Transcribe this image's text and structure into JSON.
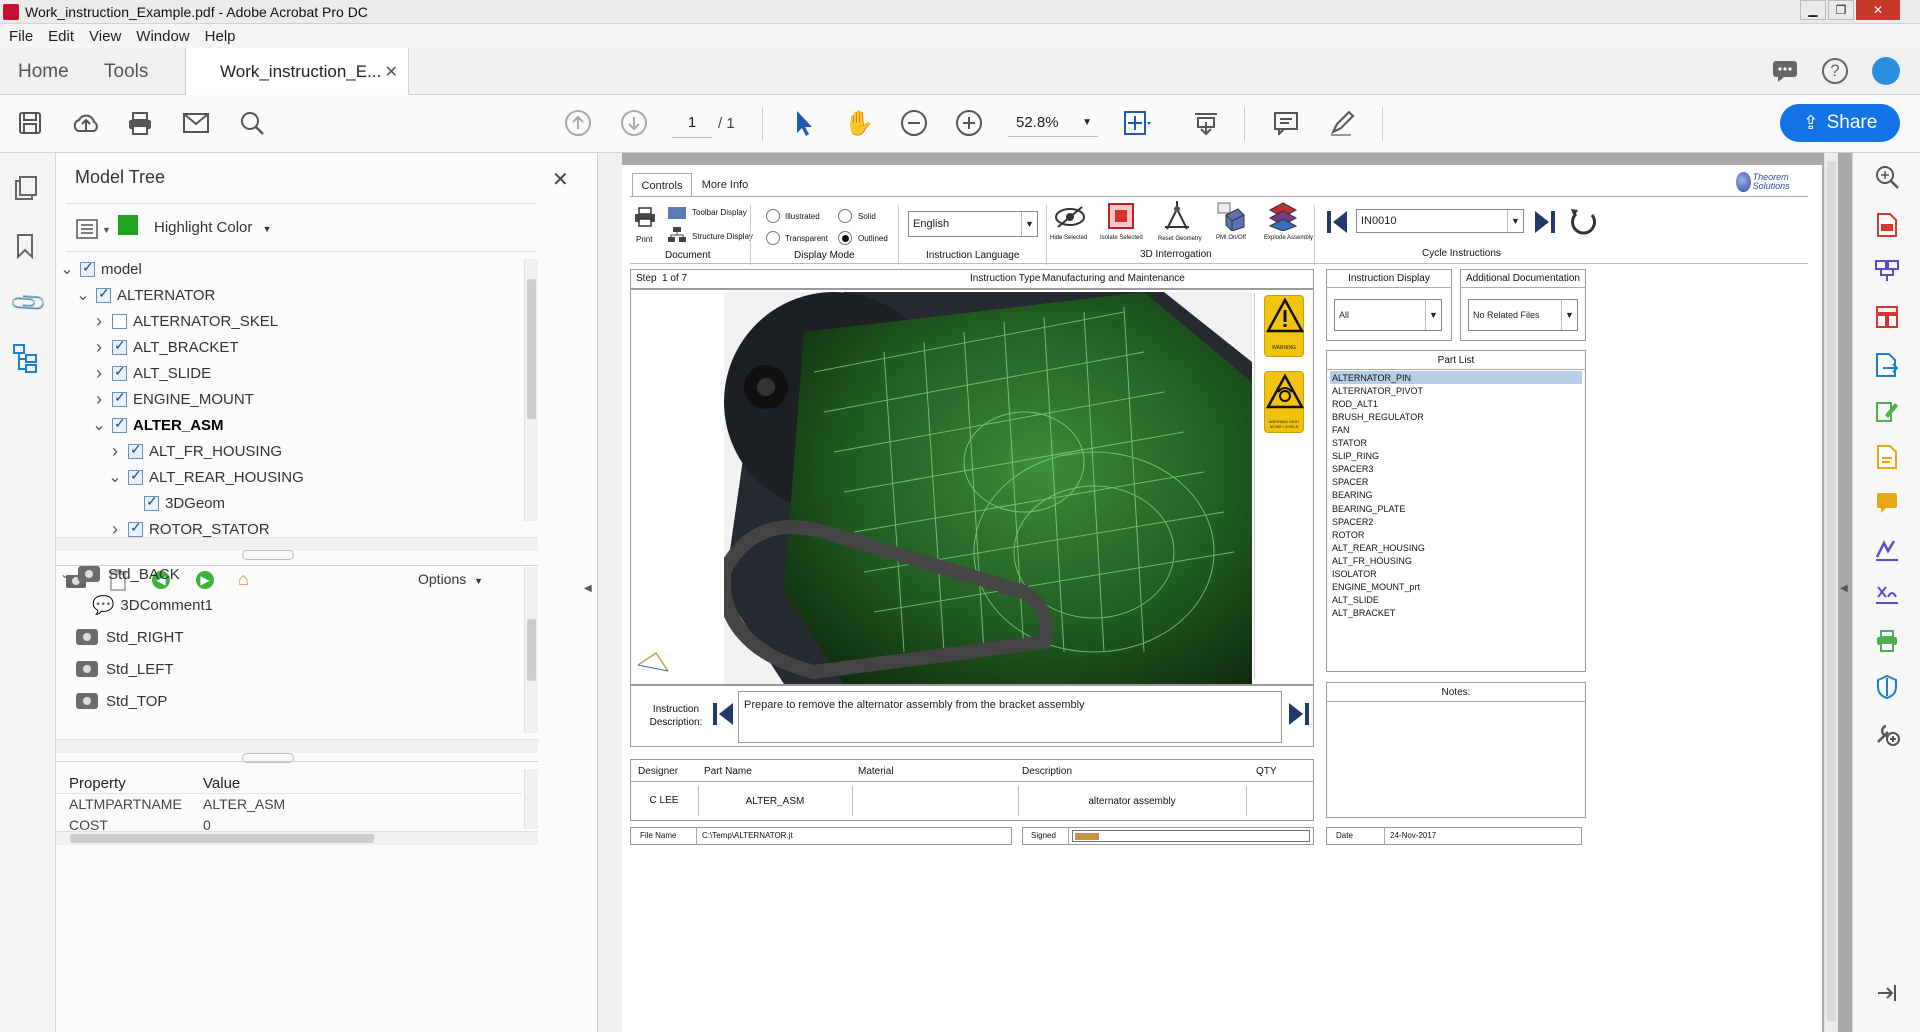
{
  "window": {
    "title": "Work_instruction_Example.pdf - Adobe Acrobat Pro DC"
  },
  "menu": [
    "File",
    "Edit",
    "View",
    "Window",
    "Help"
  ],
  "tabs": {
    "home": "Home",
    "tools": "Tools",
    "doc": "Work_instruction_E..."
  },
  "toolbar": {
    "page_current": "1",
    "page_total": "/ 1",
    "zoom": "52.8%",
    "share": "Share"
  },
  "model_tree": {
    "title": "Model Tree",
    "highlight": "Highlight Color",
    "highlight_color": "#1fa31f",
    "items": [
      {
        "label": "model",
        "level": 0,
        "expanded": true,
        "checked": true
      },
      {
        "label": "ALTERNATOR",
        "level": 1,
        "expanded": true,
        "checked": true
      },
      {
        "label": "ALTERNATOR_SKEL",
        "level": 2,
        "expanded": false,
        "checked": false
      },
      {
        "label": "ALT_BRACKET",
        "level": 2,
        "expanded": false,
        "checked": true
      },
      {
        "label": "ALT_SLIDE",
        "level": 2,
        "expanded": false,
        "checked": true
      },
      {
        "label": "ENGINE_MOUNT",
        "level": 2,
        "expanded": false,
        "checked": true
      },
      {
        "label": "ALTER_ASM",
        "level": 2,
        "expanded": true,
        "checked": true,
        "bold": true
      },
      {
        "label": "ALT_FR_HOUSING",
        "level": 3,
        "expanded": false,
        "checked": true
      },
      {
        "label": "ALT_REAR_HOUSING",
        "level": 3,
        "expanded": true,
        "checked": true
      },
      {
        "label": "3DGeom",
        "level": 4,
        "checked": true,
        "leaf": true
      },
      {
        "label": "ROTOR_STATOR",
        "level": 3,
        "expanded": false,
        "checked": true
      }
    ],
    "options": "Options",
    "views": [
      "Std_BACK",
      "3DComment1",
      "Std_RIGHT",
      "Std_LEFT",
      "Std_TOP"
    ],
    "property_header": "Property",
    "value_header": "Value",
    "properties": [
      {
        "name": "ALTMPARTNAME",
        "value": "ALTER_ASM"
      },
      {
        "name": "COST",
        "value": "0"
      }
    ]
  },
  "pdf": {
    "tabs": [
      "Controls",
      "More Info"
    ],
    "logo": "Theorem Solutions",
    "document": {
      "print": "Print",
      "toolbar_display": "Toolbar Display",
      "structure_display": "Structure Display",
      "caption": "Document"
    },
    "display_mode": {
      "illustrated": "Illustrated",
      "solid": "Solid",
      "transparent": "Transparent",
      "outlined": "Outlined",
      "caption": "Display Mode"
    },
    "language": {
      "value": "English",
      "caption": "Instruction Language"
    },
    "interrogation": {
      "hide": "Hide Selected",
      "isolate": "Isolate Selected",
      "reset": "Reset Geometry",
      "pmi": "PMI On/Off",
      "explode": "Explode Assembly",
      "caption": "3D Interrogation"
    },
    "cycle": {
      "value": "IN0010",
      "caption": "Cycle Instructions"
    },
    "step_label": "Step",
    "step_value": "1 of 7",
    "instr_type_label": "Instruction Type",
    "instr_type_value": "Manufacturing and Maintenance",
    "warning1": "WARNING",
    "warning2": "WARNING HIGH NOISE LEVELS",
    "instruction_display": {
      "caption": "Instruction Display",
      "value": "All"
    },
    "additional_docs": {
      "caption": "Additional Documentation",
      "value": "No Related Files"
    },
    "part_list": {
      "caption": "Part List",
      "items": [
        "ALTERNATOR_PIN",
        "ALTERNATOR_PIVOT",
        "ROD_ALT1",
        "BRUSH_REGULATOR",
        "FAN",
        "STATOR",
        "SLIP_RING",
        "SPACER3",
        "SPACER",
        "BEARING",
        "BEARING_PLATE",
        "SPACER2",
        "ROTOR",
        "ALT_REAR_HOUSING",
        "ALT_FR_HOUSING",
        "ISOLATOR",
        "ENGINE_MOUNT_prt",
        "ALT_SLIDE",
        "ALT_BRACKET"
      ]
    },
    "notes": "Notes:",
    "instruction_desc_label": "Instruction Description:",
    "instruction_desc": "Prepare to remove the alternator assembly from the bracket assembly",
    "table": {
      "headers": [
        "Designer",
        "Part Name",
        "Material",
        "Description",
        "QTY"
      ],
      "row": [
        "C LEE",
        "ALTER_ASM",
        "",
        "alternator assembly",
        ""
      ]
    },
    "file_name_label": "File Name",
    "file_name": "C:\\Temp\\ALTERNATOR.jt",
    "signed_label": "Signed",
    "date_label": "Date",
    "date": "24-Nov-2017"
  }
}
